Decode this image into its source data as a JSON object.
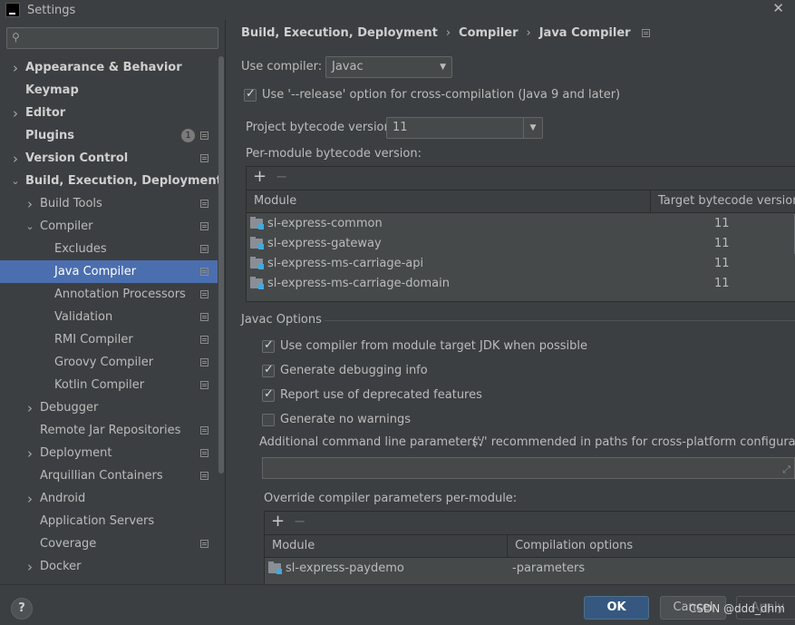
{
  "window": {
    "title": "Settings"
  },
  "search": {
    "placeholder": ""
  },
  "sidebar": {
    "items": [
      {
        "label": "Appearance & Behavior",
        "level": 0,
        "bold": true,
        "chevron": "right"
      },
      {
        "label": "Keymap",
        "level": 0,
        "bold": true,
        "chevron": "none"
      },
      {
        "label": "Editor",
        "level": 0,
        "bold": true,
        "chevron": "right"
      },
      {
        "label": "Plugins",
        "level": 0,
        "bold": true,
        "chevron": "none",
        "badge": "1",
        "project_icon": true
      },
      {
        "label": "Version Control",
        "level": 0,
        "bold": true,
        "chevron": "right",
        "project_icon": true
      },
      {
        "label": "Build, Execution, Deployment",
        "level": 0,
        "bold": true,
        "chevron": "down"
      },
      {
        "label": "Build Tools",
        "level": 1,
        "chevron": "right",
        "project_icon": true
      },
      {
        "label": "Compiler",
        "level": 1,
        "chevron": "down",
        "project_icon": true
      },
      {
        "label": "Excludes",
        "level": 2,
        "chevron": "none",
        "project_icon": true
      },
      {
        "label": "Java Compiler",
        "level": 2,
        "chevron": "none",
        "project_icon": true,
        "selected": true
      },
      {
        "label": "Annotation Processors",
        "level": 2,
        "chevron": "none",
        "project_icon": true
      },
      {
        "label": "Validation",
        "level": 2,
        "chevron": "none",
        "project_icon": true
      },
      {
        "label": "RMI Compiler",
        "level": 2,
        "chevron": "none",
        "project_icon": true
      },
      {
        "label": "Groovy Compiler",
        "level": 2,
        "chevron": "none",
        "project_icon": true
      },
      {
        "label": "Kotlin Compiler",
        "level": 2,
        "chevron": "none",
        "project_icon": true
      },
      {
        "label": "Debugger",
        "level": 1,
        "chevron": "right"
      },
      {
        "label": "Remote Jar Repositories",
        "level": 1,
        "chevron": "none",
        "project_icon": true
      },
      {
        "label": "Deployment",
        "level": 1,
        "chevron": "right",
        "project_icon": true
      },
      {
        "label": "Arquillian Containers",
        "level": 1,
        "chevron": "none",
        "project_icon": true
      },
      {
        "label": "Android",
        "level": 1,
        "chevron": "right"
      },
      {
        "label": "Application Servers",
        "level": 1,
        "chevron": "none"
      },
      {
        "label": "Coverage",
        "level": 1,
        "chevron": "none",
        "project_icon": true
      },
      {
        "label": "Docker",
        "level": 1,
        "chevron": "right"
      }
    ]
  },
  "breadcrumb": {
    "part1": "Build, Execution, Deployment",
    "part2": "Compiler",
    "part3": "Java Compiler",
    "separator": "›"
  },
  "compiler": {
    "label": "Use compiler:",
    "value": "Javac"
  },
  "release_option": {
    "label": "Use '--release' option for cross-compilation (Java 9 and later)",
    "checked": true
  },
  "bytecode": {
    "label": "Project bytecode version:",
    "value": "11"
  },
  "per_module": {
    "label": "Per-module bytecode version:",
    "columns": [
      "Module",
      "Target bytecode version"
    ],
    "rows": [
      {
        "module": "sl-express-common",
        "version": "11"
      },
      {
        "module": "sl-express-gateway",
        "version": "11"
      },
      {
        "module": "sl-express-ms-carriage-api",
        "version": "11"
      },
      {
        "module": "sl-express-ms-carriage-domain",
        "version": "11"
      }
    ]
  },
  "javac": {
    "section_title": "Javac Options",
    "options": [
      {
        "label": "Use compiler from module target JDK when possible",
        "checked": true
      },
      {
        "label": "Generate debugging info",
        "checked": true
      },
      {
        "label": "Report use of deprecated features",
        "checked": true
      },
      {
        "label": "Generate no warnings",
        "checked": false
      }
    ],
    "additional_label": "Additional command line parameters:",
    "additional_hint": "('/' recommended in paths for cross-platform configurations)",
    "additional_value": "",
    "override_label": "Override compiler parameters per-module:",
    "override_columns": [
      "Module",
      "Compilation options"
    ],
    "override_rows": [
      {
        "module": "sl-express-paydemo",
        "options": "-parameters"
      }
    ]
  },
  "footer": {
    "help": "?",
    "ok": "OK",
    "cancel": "Cancel",
    "apply": "Apply"
  },
  "watermark": "CSDN @ddd_dhm",
  "colors": {
    "selection": "#4b6eaf",
    "ok_button": "#365880",
    "module_badge": "#3fa9e0"
  }
}
